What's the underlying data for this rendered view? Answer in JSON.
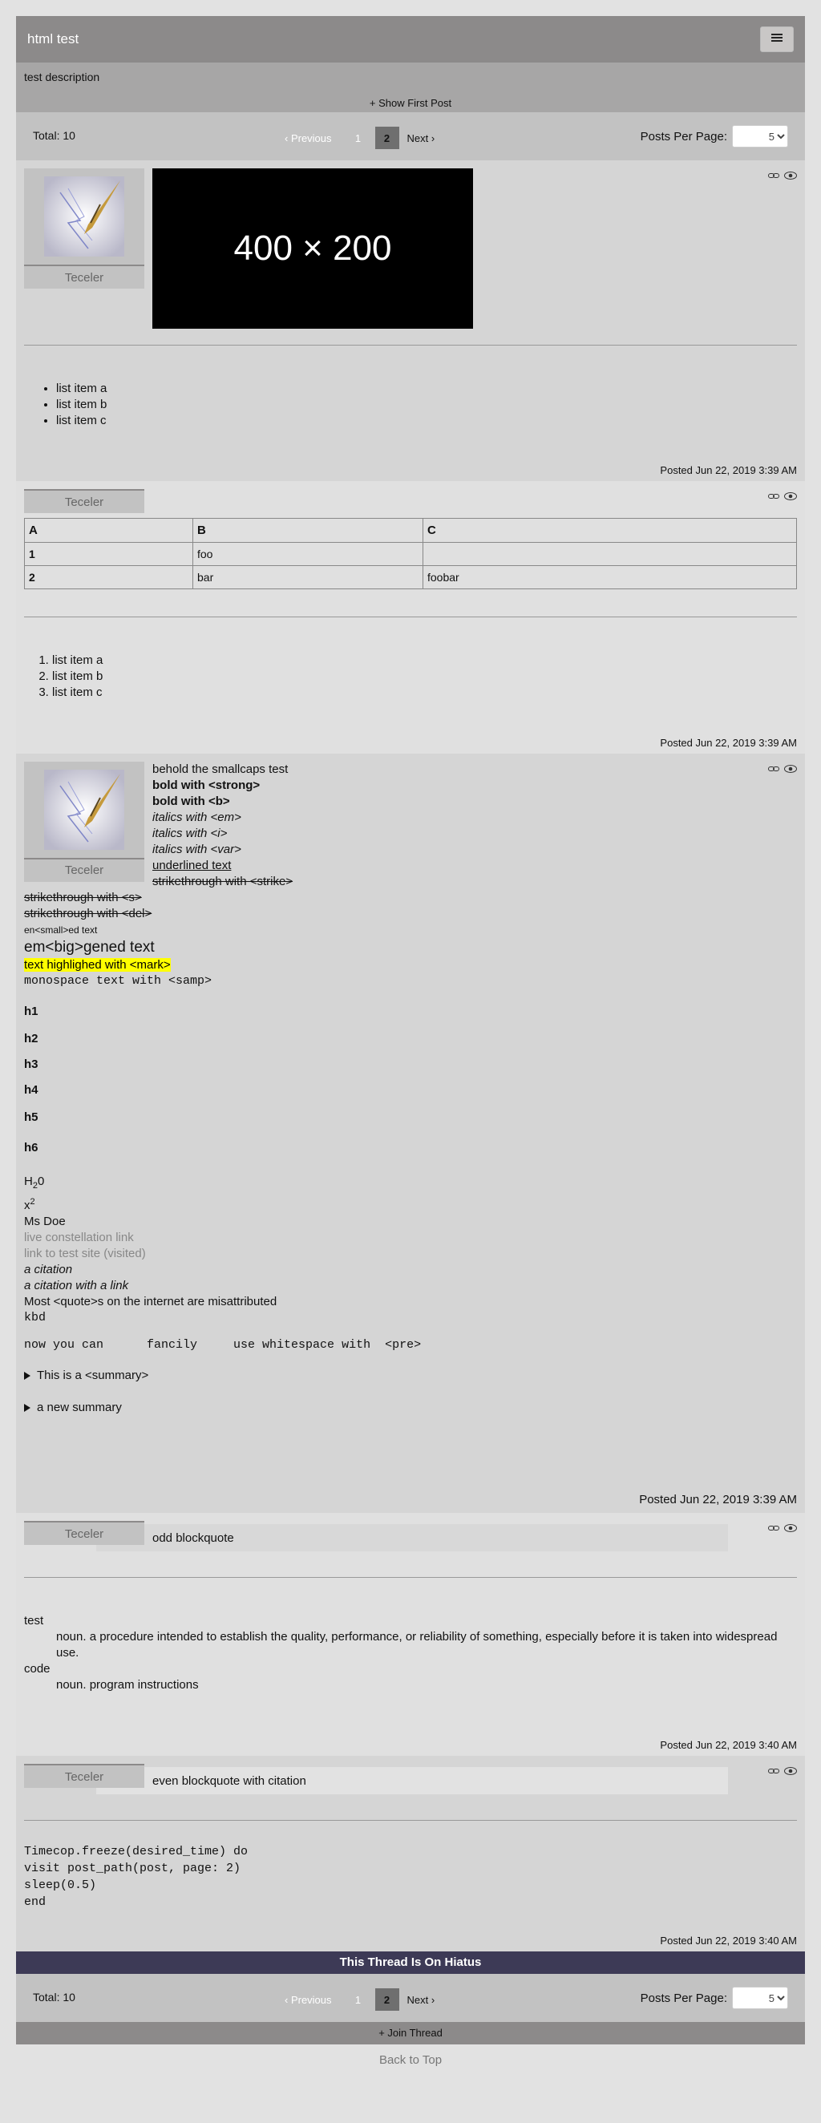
{
  "thread": {
    "title": "html test",
    "description": "test description",
    "show_first_post": "+ Show First Post",
    "hiatus_banner": "This Thread Is On Hiatus",
    "join_thread": "+ Join Thread",
    "back_to_top": "Back to Top",
    "menu_icon": "hamburger-icon"
  },
  "pagination": {
    "total": "Total: 10",
    "prev": "‹ Previous",
    "pages": [
      "1",
      "2"
    ],
    "current_page": "2",
    "next": "Next ›",
    "per_page_label": "Posts Per Page:",
    "per_page_value": "5"
  },
  "icons": {
    "link": "link-icon",
    "view": "eye-icon"
  },
  "posts": [
    {
      "author": "Teceler",
      "image_placeholder": "400 × 200",
      "list": [
        "list item a",
        "list item b",
        "list item c"
      ],
      "posted": "Posted Jun 22, 2019 3:39 AM"
    },
    {
      "author": "Teceler",
      "table": {
        "headers": [
          "A",
          "B",
          "C"
        ],
        "rows": [
          [
            "1",
            "foo",
            ""
          ],
          [
            "2",
            "bar",
            "foobar"
          ]
        ]
      },
      "list": [
        "list item a",
        "list item b",
        "list item c"
      ],
      "posted": "Posted Jun 22, 2019 3:39 AM"
    },
    {
      "author": "Teceler",
      "smallcaps": "behold the smallcaps test",
      "strong": "bold with <strong>",
      "b": "bold with <b>",
      "em": "italics with <em>",
      "i": "italics with <i>",
      "var": "italics with <var>",
      "u": "underlined text",
      "strike": "strikethrough with <strike>",
      "s": "strikethrough with <s>",
      "del": "strikethrough with <del>",
      "small": "en<small>ed text",
      "big": "em<big>gened text",
      "mark": "text highlighed with <mark>",
      "samp": "monospace text with <samp>",
      "h1": "h1",
      "h2": "h2",
      "h3": "h3",
      "h4": "h4",
      "h5": "h5",
      "h6": "h6",
      "sub_pre": "H",
      "sub": "2",
      "sub_post": "0",
      "sup_pre": "x",
      "sup": "2",
      "abbr": "Ms Doe",
      "link1": "live constellation link",
      "link2": "link to test site (visited)",
      "cite": "a citation",
      "cite_link": "a citation with a link",
      "quote": "Most <quote>s on the internet are misattributed",
      "kbd": "kbd",
      "pre": "now you can      fancily     use whitespace with  <pre>",
      "summary1": "This is a <summary>",
      "summary2": "a new summary",
      "posted": "Posted Jun 22, 2019 3:39 AM"
    },
    {
      "author": "Teceler",
      "blockquote": "odd blockquote",
      "dl": [
        {
          "term": "test",
          "def": "noun. a procedure intended to establish the quality, performance, or reliability of something, especially before it is taken into widespread use."
        },
        {
          "term": "code",
          "def": "noun. program instructions"
        }
      ],
      "posted": "Posted Jun 22, 2019 3:40 AM"
    },
    {
      "author": "Teceler",
      "blockquote": "even blockquote with citation",
      "code": [
        "Timecop.freeze(desired_time) do",
        "visit post_path(post, page: 2)",
        "sleep(0.5)",
        "end"
      ],
      "posted": "Posted Jun 22, 2019 3:40 AM"
    }
  ]
}
